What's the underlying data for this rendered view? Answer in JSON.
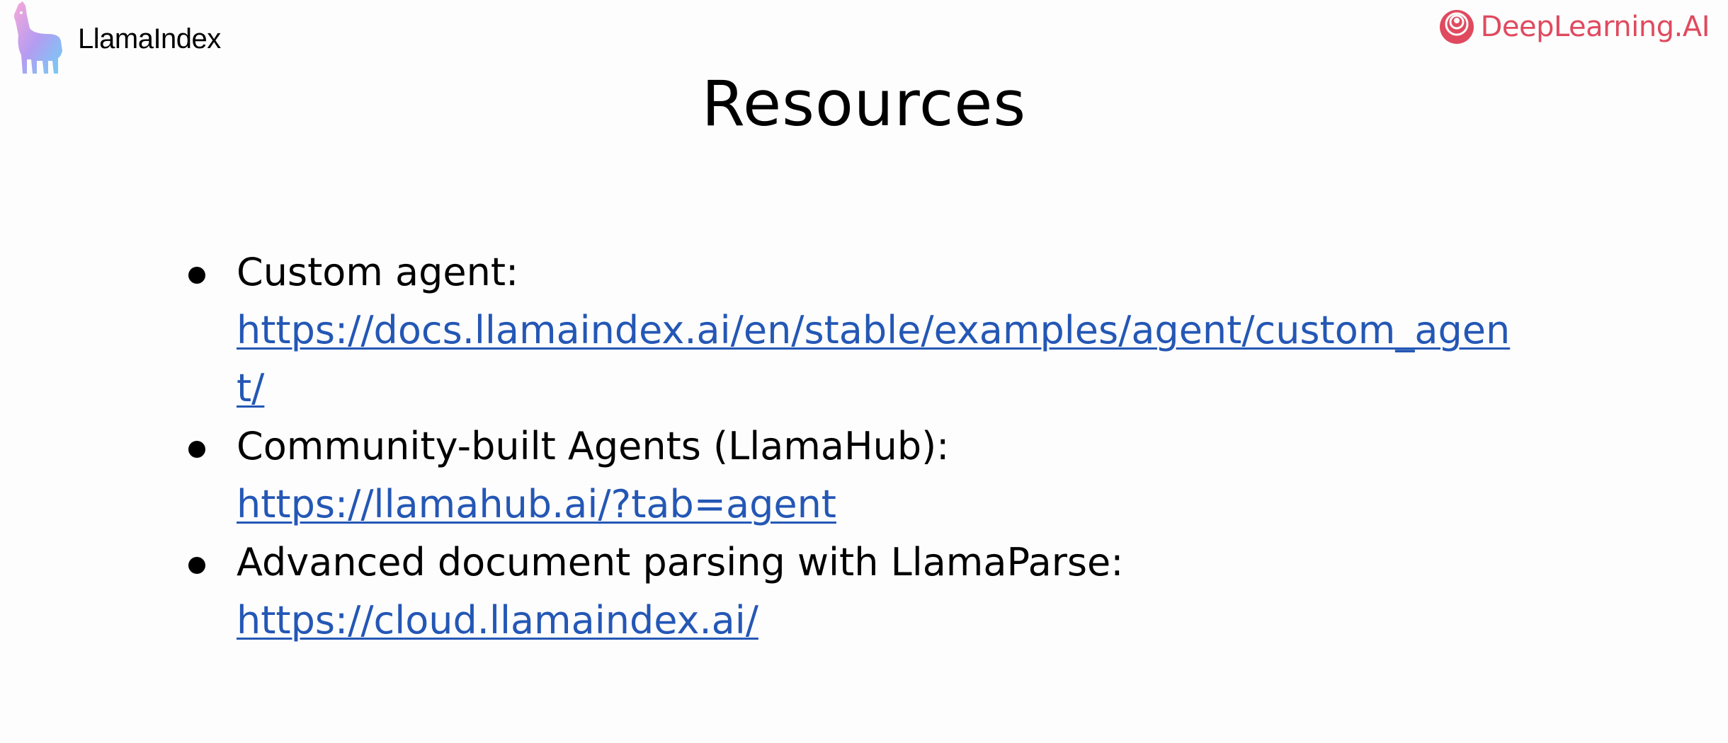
{
  "header": {
    "left_logo": {
      "icon": "llama-icon",
      "text": "LlamaIndex"
    },
    "right_logo": {
      "icon": "deeplearning-ai-icon",
      "text": "DeepLearning.AI",
      "color": "#e04a5f"
    }
  },
  "slide": {
    "title": "Resources",
    "link_color": "#2457b5",
    "items": [
      {
        "label": "Custom agent:",
        "url": "https://docs.llamaindex.ai/en/stable/examples/agent/custom_agent/"
      },
      {
        "label": "Community-built Agents (LlamaHub):",
        "url": "https://llamahub.ai/?tab=agent"
      },
      {
        "label": "Advanced document parsing with LlamaParse:",
        "url": "https://cloud.llamaindex.ai/"
      }
    ]
  }
}
